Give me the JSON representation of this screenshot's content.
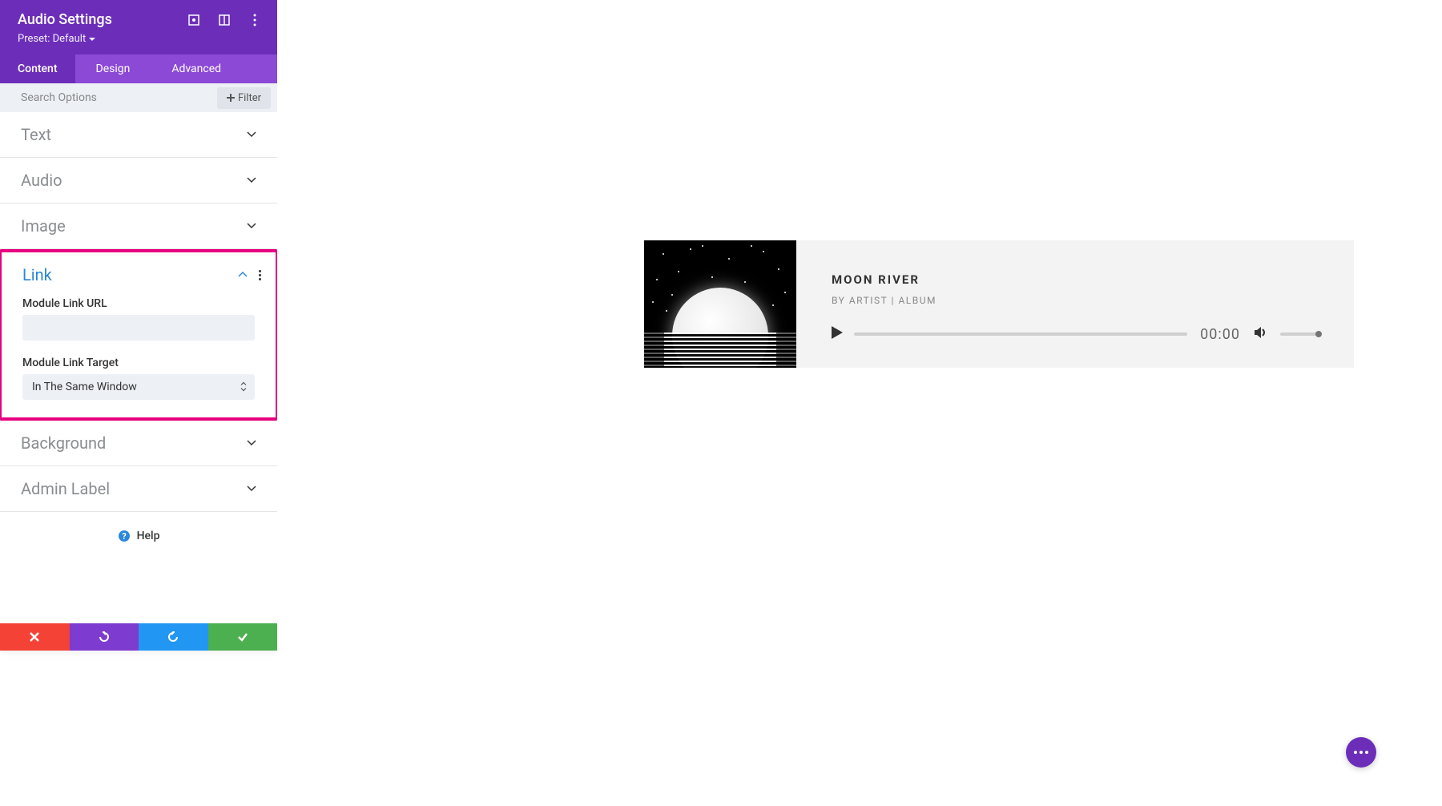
{
  "header": {
    "title": "Audio Settings",
    "preset_label": "Preset: Default"
  },
  "tabs": {
    "content": "Content",
    "design": "Design",
    "advanced": "Advanced"
  },
  "search": {
    "placeholder": "Search Options",
    "filter_label": "Filter"
  },
  "sections": {
    "text": "Text",
    "audio": "Audio",
    "image": "Image",
    "link": "Link",
    "background": "Background",
    "admin_label": "Admin Label"
  },
  "link_panel": {
    "url_label": "Module Link URL",
    "url_value": "",
    "target_label": "Module Link Target",
    "target_value": "In The Same Window"
  },
  "help_label": "Help",
  "audio_module": {
    "title": "MOON RIVER",
    "meta": "BY ARTIST | ALBUM",
    "time": "00:00"
  }
}
